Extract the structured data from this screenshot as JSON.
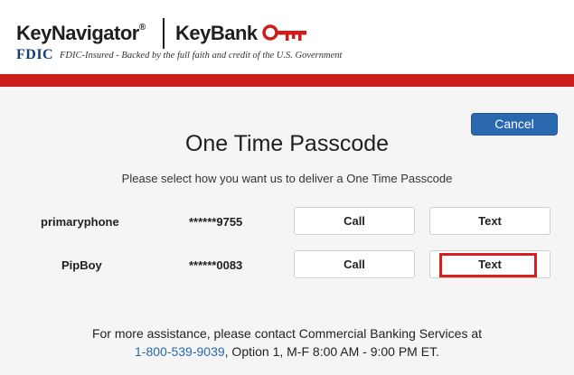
{
  "header": {
    "keynavigator_logo": "KeyNavigator",
    "registered_mark": "®",
    "keybank_logo": "KeyBank",
    "fdic_logo": "FDIC",
    "fdic_text": "FDIC-Insured - Backed by the full faith and credit of the U.S. Government"
  },
  "actions": {
    "cancel_label": "Cancel"
  },
  "page": {
    "title": "One Time Passcode",
    "subtitle": "Please select how you want us to deliver a One Time Passcode"
  },
  "devices": [
    {
      "name": "primaryphone",
      "number": "******9755",
      "call_label": "Call",
      "text_label": "Text"
    },
    {
      "name": "PipBoy",
      "number": "******0083",
      "call_label": "Call",
      "text_label": "Text"
    }
  ],
  "footer": {
    "line1": "For more assistance, please contact Commercial Banking Services at",
    "phone": "1-800-539-9039",
    "line2_rest": ", Option 1, M-F 8:00 AM - 9:00 PM ET."
  },
  "colors": {
    "brand_red": "#cc1d1d",
    "accent_blue": "#2a68b0",
    "highlight_red": "#d62020"
  },
  "icons": [
    "keybank-key-icon"
  ]
}
